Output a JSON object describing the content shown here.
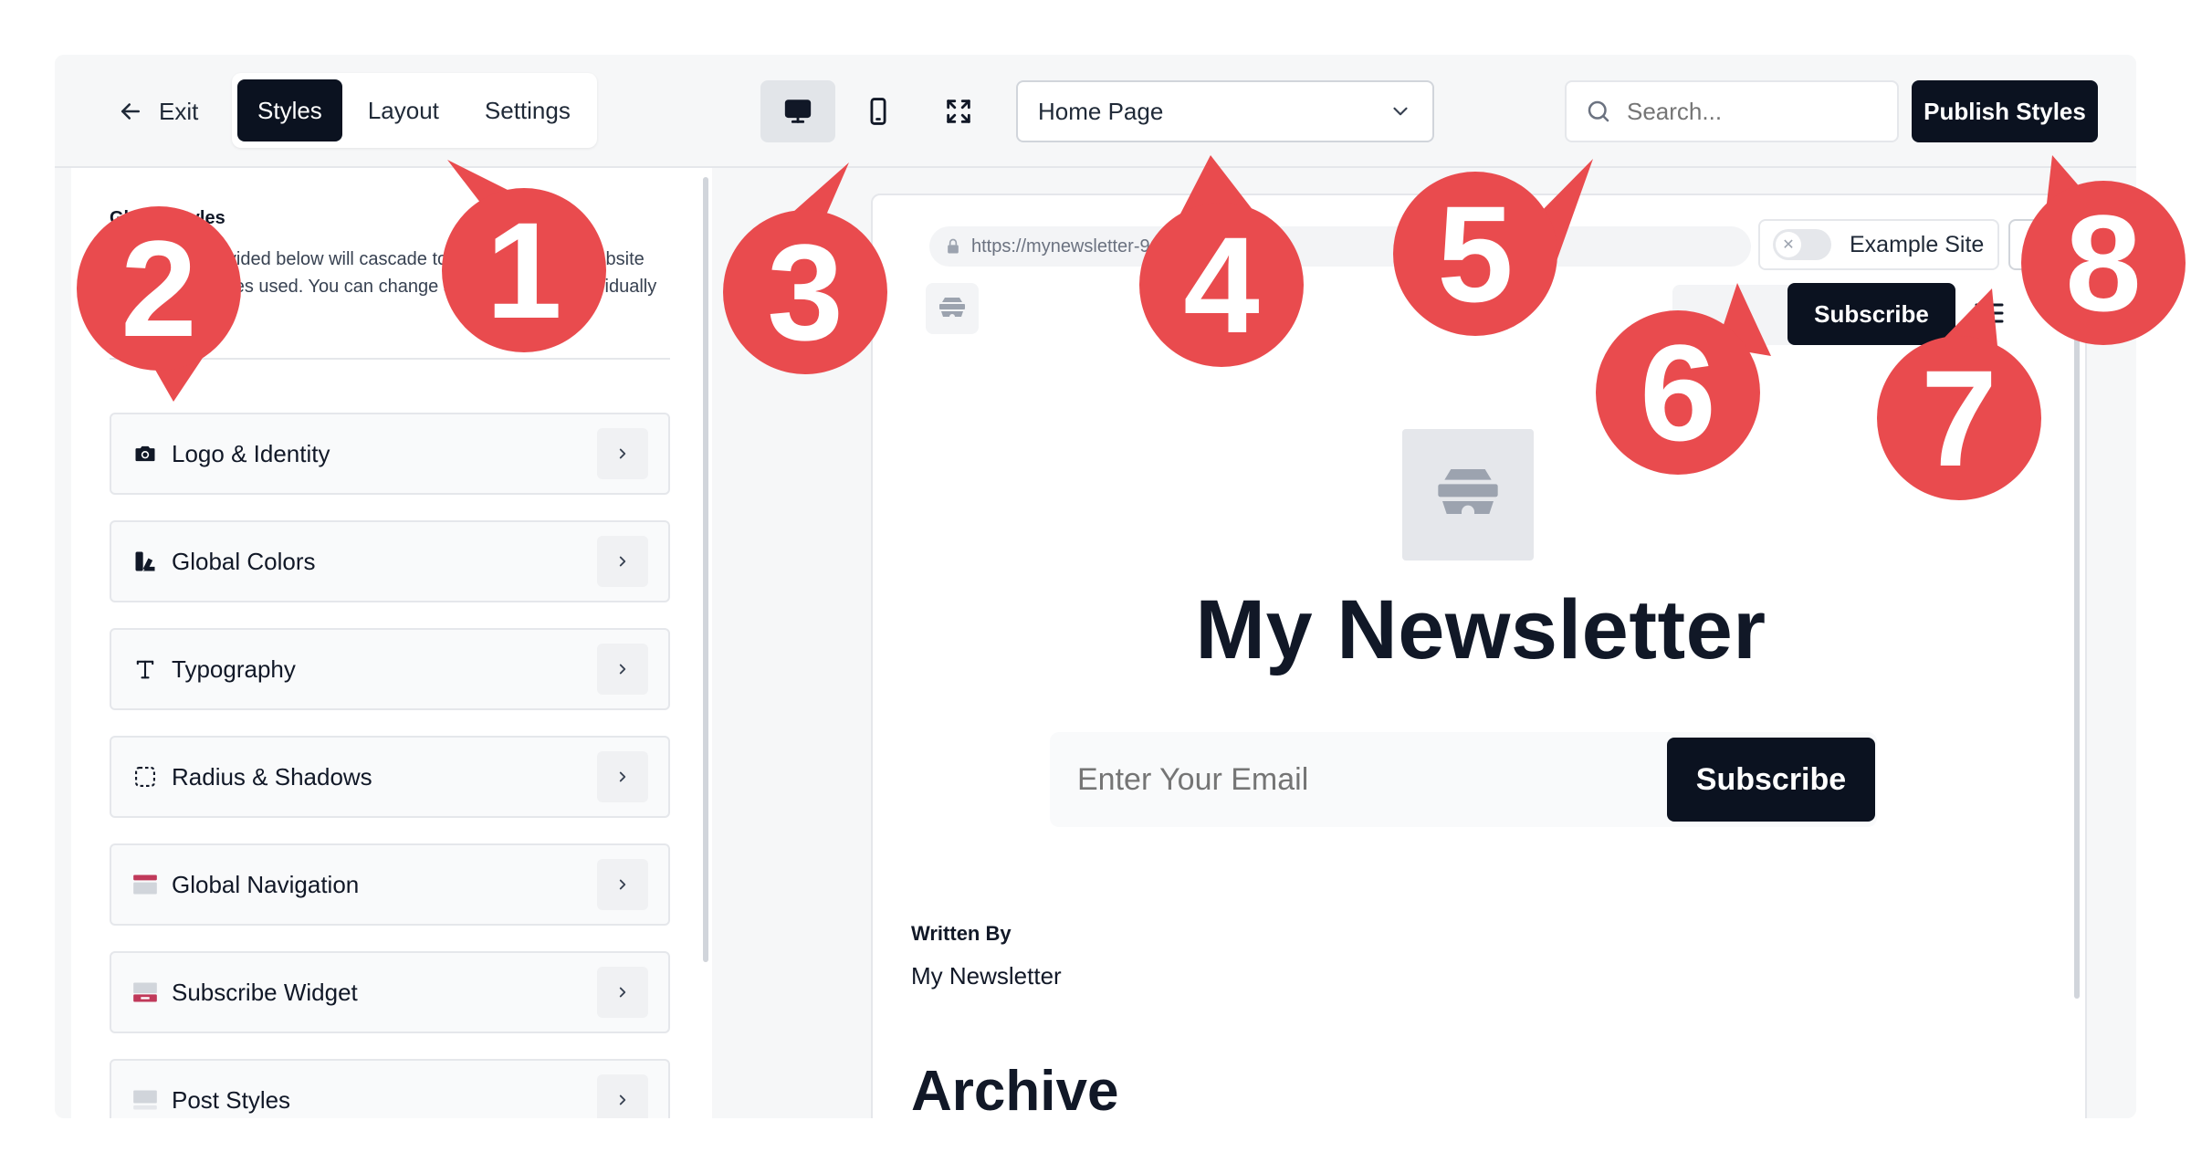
{
  "toolbar": {
    "exit_label": "Exit",
    "tabs": [
      {
        "label": "Styles",
        "active": true
      },
      {
        "label": "Layout",
        "active": false
      },
      {
        "label": "Settings",
        "active": false
      }
    ],
    "devices": [
      {
        "name": "desktop-icon",
        "active": true
      },
      {
        "name": "mobile-icon",
        "active": false
      },
      {
        "name": "fullscreen-icon",
        "active": false
      }
    ],
    "page_select": {
      "value": "Home Page"
    },
    "search": {
      "placeholder": "Search..."
    },
    "publish_label": "Publish Styles"
  },
  "sidebar": {
    "intro_title": "Global Styles",
    "intro_line1": "provided below will cascade to all parts of your website",
    "intro_line2": "values used. You can change specific values individually in",
    "items": [
      {
        "label": "Logo & Identity",
        "icon": "camera-icon"
      },
      {
        "label": "Global Colors",
        "icon": "palette-icon"
      },
      {
        "label": "Typography",
        "icon": "text-icon"
      },
      {
        "label": "Radius & Shadows",
        "icon": "dashed-square-icon"
      },
      {
        "label": "Global Navigation",
        "icon": "navigation-icon"
      },
      {
        "label": "Subscribe Widget",
        "icon": "widget-icon"
      },
      {
        "label": "Post Styles",
        "icon": "post-icon"
      }
    ]
  },
  "preview": {
    "url": "https://mynewsletter-96f383",
    "example_site_label": "Example Site",
    "nav_subscribe_label": "Subscribe",
    "site_title": "My Newsletter",
    "email_placeholder": "Enter Your Email",
    "email_subscribe_label": "Subscribe",
    "written_by_label": "Written By",
    "author_name": "My Newsletter",
    "archive_heading": "Archive"
  },
  "callouts": [
    "1",
    "2",
    "3",
    "4",
    "5",
    "6",
    "7",
    "8"
  ],
  "colors": {
    "accent_dark": "#0b1220",
    "callout_red": "#e94b4e",
    "nav_brand": "#c0395a"
  }
}
